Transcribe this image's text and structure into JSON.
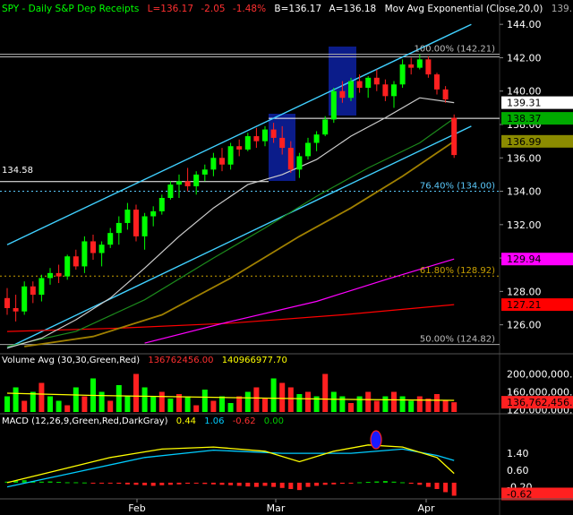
{
  "header": {
    "symbol": "SPY - Daily  S&P Dep Receipts",
    "last": "L=136.17",
    "change": "-2.05",
    "change_pct": "-1.48%",
    "bid": "B=136.17",
    "ask": "A=136.18",
    "indicator": "Mov Avg Exponential (Close,20,0)",
    "indicator_value": "139.",
    "colors": {
      "symbol": "#00ff00",
      "last": "#ff3030",
      "neutral": "#ffffff"
    }
  },
  "price_panel": {
    "ylim": [
      124.8,
      144.6
    ],
    "y_ticks": [
      "144.00",
      "142.00",
      "140.00",
      "138.00",
      "136.00",
      "134.00",
      "132.00",
      "130.00",
      "128.00",
      "126.00"
    ],
    "left_label": "134.58",
    "fib_levels": [
      {
        "label": "100.00% (142.21)",
        "value": 142.21
      },
      {
        "label": "76.40% (134.00)",
        "value": 134.0
      },
      {
        "label": "61.80% (128.92)",
        "value": 128.92
      },
      {
        "label": "50.00% (124.82)",
        "value": 124.82
      }
    ],
    "price_tags": [
      {
        "text": "139.31",
        "value": 139.31,
        "bg": "#ffffff",
        "fg": "#000000"
      },
      {
        "text": "138.37",
        "value": 138.37,
        "bg": "#00aa00",
        "fg": "#000000"
      },
      {
        "text": "136.99",
        "value": 136.99,
        "bg": "#8b8b00",
        "fg": "#000000"
      },
      {
        "text": "129.94",
        "value": 129.94,
        "bg": "#ff00ff",
        "fg": "#000000"
      },
      {
        "text": "127.21",
        "value": 127.21,
        "bg": "#ff0000",
        "fg": "#000000"
      }
    ]
  },
  "volume_panel": {
    "title": "Volume Avg (30,30,Green,Red)",
    "value_red": "136762456.00",
    "value_yellow": "140966977.70",
    "y_ticks": [
      "200,000,000.00",
      "160,000,000.00",
      "120,000,000.00"
    ],
    "tag": "136,762,456.00"
  },
  "macd_panel": {
    "title": "MACD (12,26,9,Green,Red,DarkGray)",
    "v1": "0.44",
    "v2": "1.06",
    "v3": "-0.62",
    "v4": "0.00",
    "y_ticks": [
      "1.40",
      "0.60",
      "-0.20"
    ],
    "tag": "-0.62"
  },
  "x_labels": [
    "Feb",
    "Mar",
    "Apr"
  ],
  "chart_data": {
    "type": "candlestick",
    "title": "SPY - Daily  S&P Dep Receipts",
    "ylim": [
      124.8,
      144.6
    ],
    "candles": [
      [
        127.6,
        128.2,
        126.6,
        127.0
      ],
      [
        127.0,
        127.8,
        126.2,
        126.8
      ],
      [
        126.8,
        128.6,
        126.6,
        128.3
      ],
      [
        128.3,
        128.6,
        127.3,
        127.8
      ],
      [
        127.8,
        129.0,
        127.4,
        128.8
      ],
      [
        128.8,
        129.4,
        128.4,
        129.1
      ],
      [
        129.1,
        129.6,
        128.5,
        128.9
      ],
      [
        128.9,
        130.2,
        128.7,
        130.1
      ],
      [
        130.1,
        130.5,
        129.3,
        129.5
      ],
      [
        129.5,
        131.3,
        129.1,
        131.0
      ],
      [
        131.0,
        131.4,
        129.9,
        130.3
      ],
      [
        130.3,
        131.0,
        129.5,
        130.8
      ],
      [
        130.8,
        131.8,
        130.6,
        131.5
      ],
      [
        131.5,
        132.5,
        130.8,
        132.1
      ],
      [
        132.1,
        133.3,
        131.7,
        132.9
      ],
      [
        132.9,
        133.2,
        131.0,
        131.3
      ],
      [
        131.3,
        132.7,
        130.5,
        132.5
      ],
      [
        132.5,
        133.1,
        131.9,
        132.8
      ],
      [
        132.8,
        133.8,
        132.6,
        133.6
      ],
      [
        133.6,
        134.6,
        133.5,
        134.4
      ],
      [
        134.4,
        135.0,
        133.6,
        134.6
      ],
      [
        134.6,
        135.4,
        134.0,
        134.3
      ],
      [
        134.3,
        135.2,
        133.8,
        135.0
      ],
      [
        135.0,
        135.6,
        134.6,
        135.3
      ],
      [
        135.3,
        136.3,
        134.9,
        136.0
      ],
      [
        136.0,
        136.6,
        135.2,
        135.6
      ],
      [
        135.6,
        136.9,
        135.3,
        136.7
      ],
      [
        136.7,
        137.1,
        136.1,
        136.5
      ],
      [
        136.5,
        137.5,
        136.4,
        137.3
      ],
      [
        137.3,
        137.8,
        136.6,
        137.0
      ],
      [
        137.0,
        137.9,
        136.7,
        137.7
      ],
      [
        137.7,
        138.1,
        136.9,
        137.2
      ],
      [
        137.2,
        137.9,
        136.2,
        136.6
      ],
      [
        136.6,
        137.0,
        135.1,
        135.3
      ],
      [
        135.3,
        136.3,
        134.8,
        136.1
      ],
      [
        136.1,
        137.2,
        135.9,
        136.9
      ],
      [
        136.9,
        137.6,
        136.4,
        137.4
      ],
      [
        137.4,
        138.5,
        137.3,
        138.3
      ],
      [
        138.3,
        140.2,
        138.1,
        140.0
      ],
      [
        140.0,
        140.6,
        139.3,
        139.6
      ],
      [
        139.6,
        140.8,
        139.4,
        140.6
      ],
      [
        140.6,
        141.0,
        139.9,
        140.2
      ],
      [
        140.2,
        140.9,
        139.6,
        140.8
      ],
      [
        140.8,
        141.3,
        140.0,
        140.4
      ],
      [
        140.4,
        140.7,
        139.4,
        139.7
      ],
      [
        139.7,
        140.6,
        139.0,
        140.4
      ],
      [
        140.4,
        141.9,
        140.2,
        141.6
      ],
      [
        141.6,
        142.0,
        141.0,
        141.4
      ],
      [
        141.4,
        142.2,
        141.3,
        141.9
      ],
      [
        141.9,
        142.1,
        140.8,
        141.0
      ],
      [
        141.0,
        141.1,
        139.8,
        140.1
      ],
      [
        140.1,
        140.3,
        139.3,
        139.5
      ],
      [
        138.4,
        138.6,
        136.0,
        136.17
      ]
    ],
    "ema_20": [
      [
        0,
        124.6
      ],
      [
        4,
        125.2
      ],
      [
        8,
        126.3
      ],
      [
        12,
        127.6
      ],
      [
        16,
        129.4
      ],
      [
        20,
        131.3
      ],
      [
        24,
        133.0
      ],
      [
        28,
        134.4
      ],
      [
        32,
        135.0
      ],
      [
        36,
        135.9
      ],
      [
        40,
        137.3
      ],
      [
        44,
        138.4
      ],
      [
        48,
        139.6
      ],
      [
        52,
        139.31
      ]
    ],
    "ma_50": [
      [
        0,
        124.7
      ],
      [
        8,
        125.6
      ],
      [
        16,
        127.5
      ],
      [
        24,
        130.0
      ],
      [
        30,
        131.8
      ],
      [
        36,
        133.7
      ],
      [
        42,
        135.4
      ],
      [
        48,
        136.9
      ],
      [
        52,
        138.37
      ]
    ],
    "ma_100": [
      [
        2,
        124.7
      ],
      [
        10,
        125.3
      ],
      [
        18,
        126.6
      ],
      [
        26,
        128.8
      ],
      [
        34,
        131.3
      ],
      [
        40,
        133.0
      ],
      [
        46,
        134.9
      ],
      [
        52,
        136.99
      ]
    ],
    "ma_200": [
      [
        16,
        124.9
      ],
      [
        26,
        126.2
      ],
      [
        36,
        127.4
      ],
      [
        44,
        128.7
      ],
      [
        52,
        129.94
      ]
    ],
    "ma_red": [
      [
        0,
        125.6
      ],
      [
        13,
        125.8
      ],
      [
        26,
        126.1
      ],
      [
        39,
        126.6
      ],
      [
        52,
        127.21
      ]
    ],
    "channel_upper": [
      [
        0,
        130.8
      ],
      [
        54,
        144.0
      ]
    ],
    "channel_mid": [
      [
        0,
        124.6
      ],
      [
        54,
        137.9
      ]
    ],
    "volume": [
      [
        150,
        "g"
      ],
      [
        170,
        "g"
      ],
      [
        140,
        "r"
      ],
      [
        160,
        "g"
      ],
      [
        180,
        "r"
      ],
      [
        150,
        "g"
      ],
      [
        140,
        "g"
      ],
      [
        130,
        "r"
      ],
      [
        170,
        "g"
      ],
      [
        150,
        "r"
      ],
      [
        190,
        "g"
      ],
      [
        160,
        "g"
      ],
      [
        140,
        "r"
      ],
      [
        175,
        "g"
      ],
      [
        150,
        "g"
      ],
      [
        200,
        "r"
      ],
      [
        170,
        "g"
      ],
      [
        150,
        "g"
      ],
      [
        160,
        "r"
      ],
      [
        145,
        "g"
      ],
      [
        155,
        "r"
      ],
      [
        150,
        "g"
      ],
      [
        130,
        "r"
      ],
      [
        165,
        "g"
      ],
      [
        140,
        "r"
      ],
      [
        150,
        "g"
      ],
      [
        135,
        "g"
      ],
      [
        150,
        "r"
      ],
      [
        160,
        "g"
      ],
      [
        170,
        "r"
      ],
      [
        145,
        "r"
      ],
      [
        190,
        "g"
      ],
      [
        180,
        "r"
      ],
      [
        170,
        "r"
      ],
      [
        155,
        "g"
      ],
      [
        160,
        "r"
      ],
      [
        150,
        "g"
      ],
      [
        200,
        "r"
      ],
      [
        160,
        "g"
      ],
      [
        150,
        "g"
      ],
      [
        135,
        "r"
      ],
      [
        150,
        "g"
      ],
      [
        160,
        "r"
      ],
      [
        140,
        "r"
      ],
      [
        150,
        "g"
      ],
      [
        160,
        "r"
      ],
      [
        150,
        "g"
      ],
      [
        140,
        "g"
      ],
      [
        150,
        "r"
      ],
      [
        145,
        "r"
      ],
      [
        155,
        "r"
      ],
      [
        140,
        "r"
      ],
      [
        136.76,
        "r"
      ]
    ],
    "volume_avg": [
      [
        0,
        157
      ],
      [
        10,
        152
      ],
      [
        20,
        149
      ],
      [
        30,
        146
      ],
      [
        40,
        143
      ],
      [
        52,
        140.97
      ]
    ],
    "volume_ylim": [
      115,
      215
    ],
    "macd_line": [
      [
        0,
        0.0
      ],
      [
        6,
        0.6
      ],
      [
        12,
        1.2
      ],
      [
        18,
        1.6
      ],
      [
        24,
        1.7
      ],
      [
        30,
        1.5
      ],
      [
        34,
        1.0
      ],
      [
        38,
        1.5
      ],
      [
        42,
        1.8
      ],
      [
        46,
        1.7
      ],
      [
        50,
        1.2
      ],
      [
        52,
        0.44
      ]
    ],
    "signal_line": [
      [
        0,
        -0.2
      ],
      [
        8,
        0.5
      ],
      [
        16,
        1.2
      ],
      [
        24,
        1.55
      ],
      [
        32,
        1.4
      ],
      [
        40,
        1.4
      ],
      [
        46,
        1.6
      ],
      [
        50,
        1.3
      ],
      [
        52,
        1.06
      ]
    ],
    "histogram": [
      0.05,
      0.1,
      0.12,
      0.08,
      0.05,
      0.06,
      0.04,
      0.02,
      0.02,
      0.01,
      -0.01,
      -0.02,
      -0.03,
      -0.05,
      -0.08,
      -0.1,
      -0.12,
      -0.15,
      -0.12,
      -0.1,
      -0.08,
      -0.05,
      -0.04,
      -0.06,
      -0.08,
      -0.1,
      -0.12,
      -0.15,
      -0.18,
      -0.2,
      -0.15,
      -0.2,
      -0.25,
      -0.3,
      -0.35,
      -0.2,
      -0.15,
      -0.1,
      -0.08,
      -0.05,
      -0.02,
      0.02,
      0.04,
      0.06,
      0.08,
      0.05,
      0.02,
      -0.05,
      -0.1,
      -0.2,
      -0.3,
      -0.45,
      -0.62
    ],
    "macd_ylim": [
      -0.6,
      2.6
    ]
  }
}
